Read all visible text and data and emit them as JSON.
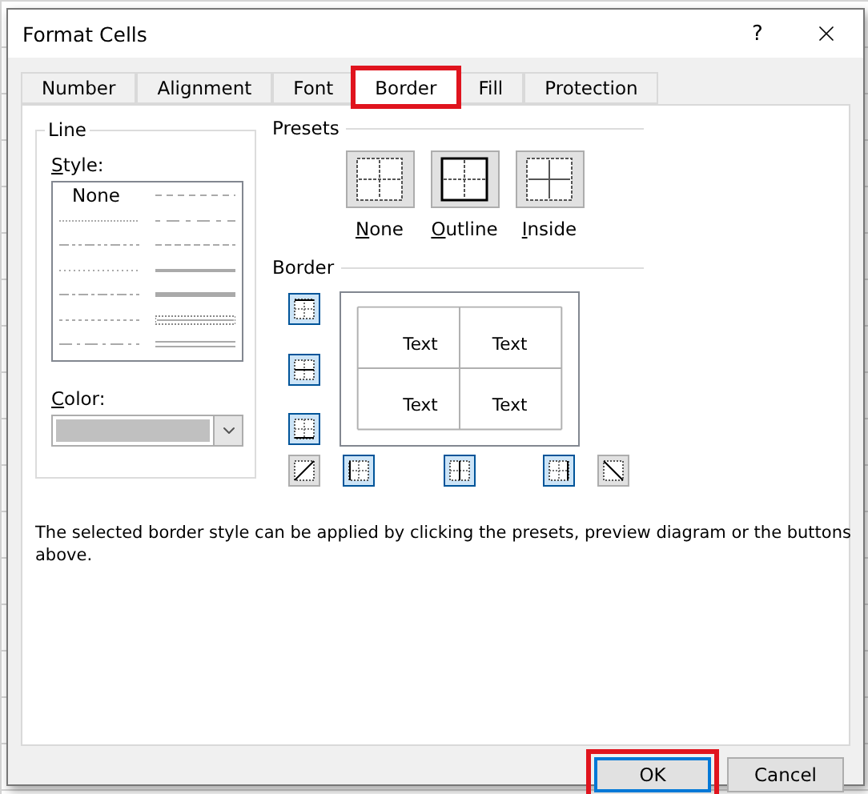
{
  "window": {
    "title": "Format Cells",
    "help": "?"
  },
  "tabs": [
    {
      "label": "Number",
      "selected": false,
      "highlighted": false
    },
    {
      "label": "Alignment",
      "selected": false,
      "highlighted": false
    },
    {
      "label": "Font",
      "selected": false,
      "highlighted": false
    },
    {
      "label": "Border",
      "selected": true,
      "highlighted": true
    },
    {
      "label": "Fill",
      "selected": false,
      "highlighted": false
    },
    {
      "label": "Protection",
      "selected": false,
      "highlighted": false
    }
  ],
  "line": {
    "title": "Line",
    "style_label": "Style:",
    "style_none": "None",
    "color_label": "Color:"
  },
  "presets": {
    "title": "Presets",
    "items": [
      {
        "label": "None",
        "kind": "none"
      },
      {
        "label": "Outline",
        "kind": "outline"
      },
      {
        "label": "Inside",
        "kind": "inside"
      }
    ]
  },
  "border": {
    "title": "Border",
    "preview_texts": [
      "Text",
      "Text",
      "Text",
      "Text"
    ],
    "buttons": [
      {
        "kind": "top",
        "selected": true
      },
      {
        "kind": "middle-horizontal",
        "selected": true
      },
      {
        "kind": "bottom",
        "selected": true
      },
      {
        "kind": "diagonal-up",
        "selected": false
      },
      {
        "kind": "left",
        "selected": true
      },
      {
        "kind": "middle-vertical",
        "selected": true
      },
      {
        "kind": "right",
        "selected": true
      },
      {
        "kind": "diagonal-down",
        "selected": false
      }
    ]
  },
  "description": "The selected border style can be applied by clicking the presets, preview diagram or the buttons above.",
  "buttons": [
    {
      "label": "OK",
      "default": true,
      "highlighted": true
    },
    {
      "label": "Cancel",
      "default": false,
      "highlighted": false
    }
  ]
}
